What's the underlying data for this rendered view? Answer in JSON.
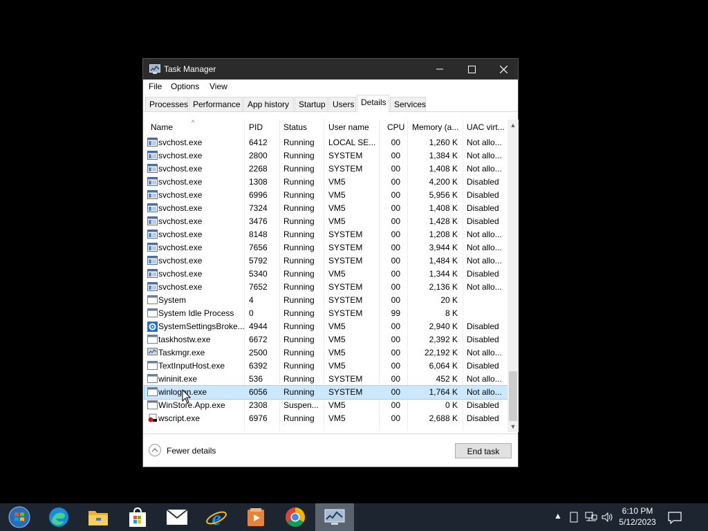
{
  "window": {
    "title": "Task Manager",
    "app_icon": "task-manager-icon"
  },
  "caption": {
    "minimize": "minimize-icon",
    "maximize": "maximize-icon",
    "close": "close-icon"
  },
  "menu": [
    "File",
    "Options",
    "View"
  ],
  "tabs": [
    "Processes",
    "Performance",
    "App history",
    "Startup",
    "Users",
    "Details",
    "Services"
  ],
  "active_tab": "Details",
  "columns": [
    "Name",
    "PID",
    "Status",
    "User name",
    "CPU",
    "Memory (a...",
    "UAC virt..."
  ],
  "sort_indicator": "^",
  "rows": [
    {
      "name": "svchost.exe",
      "pid": "6412",
      "status": "Running",
      "user": "LOCAL SE...",
      "cpu": "00",
      "mem": "1,260 K",
      "uac": "Not allo...",
      "icon": "service-host-icon"
    },
    {
      "name": "svchost.exe",
      "pid": "2800",
      "status": "Running",
      "user": "SYSTEM",
      "cpu": "00",
      "mem": "1,384 K",
      "uac": "Not allo...",
      "icon": "service-host-icon"
    },
    {
      "name": "svchost.exe",
      "pid": "2268",
      "status": "Running",
      "user": "SYSTEM",
      "cpu": "00",
      "mem": "1,408 K",
      "uac": "Not allo...",
      "icon": "service-host-icon"
    },
    {
      "name": "svchost.exe",
      "pid": "1308",
      "status": "Running",
      "user": "VM5",
      "cpu": "00",
      "mem": "4,200 K",
      "uac": "Disabled",
      "icon": "service-host-icon"
    },
    {
      "name": "svchost.exe",
      "pid": "6996",
      "status": "Running",
      "user": "VM5",
      "cpu": "00",
      "mem": "5,956 K",
      "uac": "Disabled",
      "icon": "service-host-icon"
    },
    {
      "name": "svchost.exe",
      "pid": "7324",
      "status": "Running",
      "user": "VM5",
      "cpu": "00",
      "mem": "1,408 K",
      "uac": "Disabled",
      "icon": "service-host-icon"
    },
    {
      "name": "svchost.exe",
      "pid": "3476",
      "status": "Running",
      "user": "VM5",
      "cpu": "00",
      "mem": "1,428 K",
      "uac": "Disabled",
      "icon": "service-host-icon"
    },
    {
      "name": "svchost.exe",
      "pid": "8148",
      "status": "Running",
      "user": "SYSTEM",
      "cpu": "00",
      "mem": "1,208 K",
      "uac": "Not allo...",
      "icon": "service-host-icon"
    },
    {
      "name": "svchost.exe",
      "pid": "7656",
      "status": "Running",
      "user": "SYSTEM",
      "cpu": "00",
      "mem": "3,944 K",
      "uac": "Not allo...",
      "icon": "service-host-icon"
    },
    {
      "name": "svchost.exe",
      "pid": "5792",
      "status": "Running",
      "user": "SYSTEM",
      "cpu": "00",
      "mem": "1,484 K",
      "uac": "Not allo...",
      "icon": "service-host-icon"
    },
    {
      "name": "svchost.exe",
      "pid": "5340",
      "status": "Running",
      "user": "VM5",
      "cpu": "00",
      "mem": "1,344 K",
      "uac": "Disabled",
      "icon": "service-host-icon"
    },
    {
      "name": "svchost.exe",
      "pid": "7652",
      "status": "Running",
      "user": "SYSTEM",
      "cpu": "00",
      "mem": "2,136 K",
      "uac": "Not allo...",
      "icon": "service-host-icon"
    },
    {
      "name": "System",
      "pid": "4",
      "status": "Running",
      "user": "SYSTEM",
      "cpu": "00",
      "mem": "20 K",
      "uac": "",
      "icon": "window-icon"
    },
    {
      "name": "System Idle Process",
      "pid": "0",
      "status": "Running",
      "user": "SYSTEM",
      "cpu": "99",
      "mem": "8 K",
      "uac": "",
      "icon": "window-icon"
    },
    {
      "name": "SystemSettingsBroke...",
      "pid": "4944",
      "status": "Running",
      "user": "VM5",
      "cpu": "00",
      "mem": "2,940 K",
      "uac": "Disabled",
      "icon": "gear-icon"
    },
    {
      "name": "taskhostw.exe",
      "pid": "6672",
      "status": "Running",
      "user": "VM5",
      "cpu": "00",
      "mem": "2,392 K",
      "uac": "Disabled",
      "icon": "window-icon"
    },
    {
      "name": "Taskmgr.exe",
      "pid": "2500",
      "status": "Running",
      "user": "VM5",
      "cpu": "00",
      "mem": "22,192 K",
      "uac": "Not allo...",
      "icon": "task-manager-icon"
    },
    {
      "name": "TextInputHost.exe",
      "pid": "6392",
      "status": "Running",
      "user": "VM5",
      "cpu": "00",
      "mem": "6,064 K",
      "uac": "Disabled",
      "icon": "window-icon"
    },
    {
      "name": "wininit.exe",
      "pid": "536",
      "status": "Running",
      "user": "SYSTEM",
      "cpu": "00",
      "mem": "452 K",
      "uac": "Not allo...",
      "icon": "window-icon"
    },
    {
      "name": "winlogon.exe",
      "pid": "6056",
      "status": "Running",
      "user": "SYSTEM",
      "cpu": "00",
      "mem": "1,764 K",
      "uac": "Not allo...",
      "icon": "window-icon",
      "selected": true
    },
    {
      "name": "WinStore.App.exe",
      "pid": "2308",
      "status": "Suspen...",
      "user": "VM5",
      "cpu": "00",
      "mem": "0 K",
      "uac": "Disabled",
      "icon": "window-icon"
    },
    {
      "name": "wscript.exe",
      "pid": "6976",
      "status": "Running",
      "user": "VM5",
      "cpu": "00",
      "mem": "2,688 K",
      "uac": "Disabled",
      "icon": "script-icon"
    }
  ],
  "footer": {
    "fewer_details": "Fewer details",
    "end_task": "End task"
  },
  "taskbar": {
    "items": [
      "start-icon",
      "edge-icon",
      "file-explorer-icon",
      "store-icon",
      "mail-icon",
      "internet-explorer-icon",
      "media-player-icon",
      "chrome-icon",
      "task-manager-icon"
    ],
    "active_item": "task-manager-icon",
    "tray": [
      "chevron-up-icon",
      "tablet-icon",
      "network-icon",
      "volume-icon"
    ],
    "time": "6:10 PM",
    "date": "5/12/2023",
    "notification_icon": "notification-icon"
  },
  "colors": {
    "titlebar": "#2b2b2b",
    "selection": "#cce8ff",
    "taskbar": "#1c2530",
    "desktop": "#000000"
  }
}
